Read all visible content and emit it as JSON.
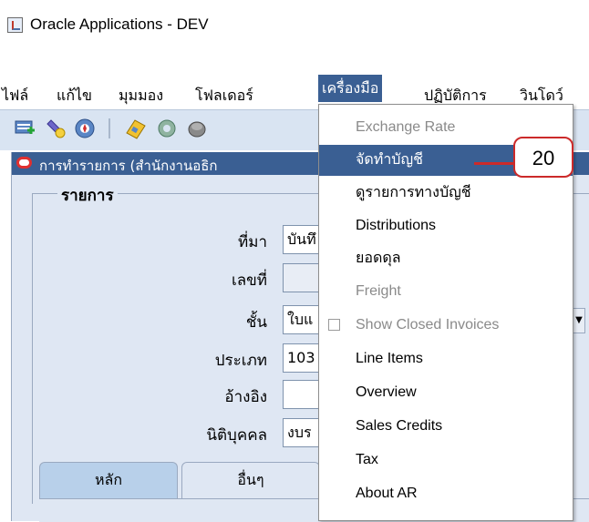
{
  "window": {
    "title": "Oracle Applications - DEV"
  },
  "menubar": {
    "items": [
      {
        "label": "ไฟล์"
      },
      {
        "label": "แก้ไข"
      },
      {
        "label": "มุมมอง"
      },
      {
        "label": "โฟลเดอร์"
      },
      {
        "label": "เครื่องมือ",
        "open": true
      },
      {
        "label": "ปฏิบัติการ"
      },
      {
        "label": "วินโดว์"
      }
    ]
  },
  "toolbar": {
    "icons": [
      "new-record-icon",
      "find-flashlight-icon",
      "navigator-icon",
      "save-icon",
      "next-step-icon",
      "print-icon"
    ]
  },
  "form": {
    "title": "การทำรายการ (สำนักงานอธิก",
    "group_label": "รายการ",
    "fields": [
      {
        "label": "ที่มา",
        "value": "บันทึ"
      },
      {
        "label": "เลขที่",
        "value": ""
      },
      {
        "label": "ชั้น",
        "value": "ใบแ"
      },
      {
        "label": "ประเภท",
        "value": "103"
      },
      {
        "label": "อ้างอิง",
        "value": ""
      },
      {
        "label": "นิติบุคคล",
        "value": "งบร"
      }
    ],
    "tabs": [
      {
        "label": "หลัก",
        "active": true
      },
      {
        "label": "อื่นๆ",
        "active": false
      }
    ]
  },
  "dropdown": {
    "items": [
      {
        "label": "Exchange Rate",
        "enabled": false
      },
      {
        "label": "จัดทำบัญชี",
        "enabled": true,
        "highlighted": true
      },
      {
        "label": "ดูรายการทางบัญชี",
        "enabled": true
      },
      {
        "label": "Distributions",
        "enabled": true
      },
      {
        "label": "ยอดดุล",
        "enabled": true
      },
      {
        "label": "Freight",
        "enabled": false
      },
      {
        "label": "Show Closed Invoices",
        "enabled": false,
        "checkbox": true
      },
      {
        "label": "Line Items",
        "enabled": true
      },
      {
        "label": "Overview",
        "enabled": true
      },
      {
        "label": "Sales Credits",
        "enabled": true
      },
      {
        "label": "Tax",
        "enabled": true
      },
      {
        "label": "About AR",
        "enabled": true
      }
    ]
  },
  "callout": {
    "text": "20"
  },
  "colors": {
    "accent": "#3a5f93",
    "callout": "#cc2a2a",
    "panel": "#dfe7f3",
    "toolbar": "#d9e4f2"
  }
}
